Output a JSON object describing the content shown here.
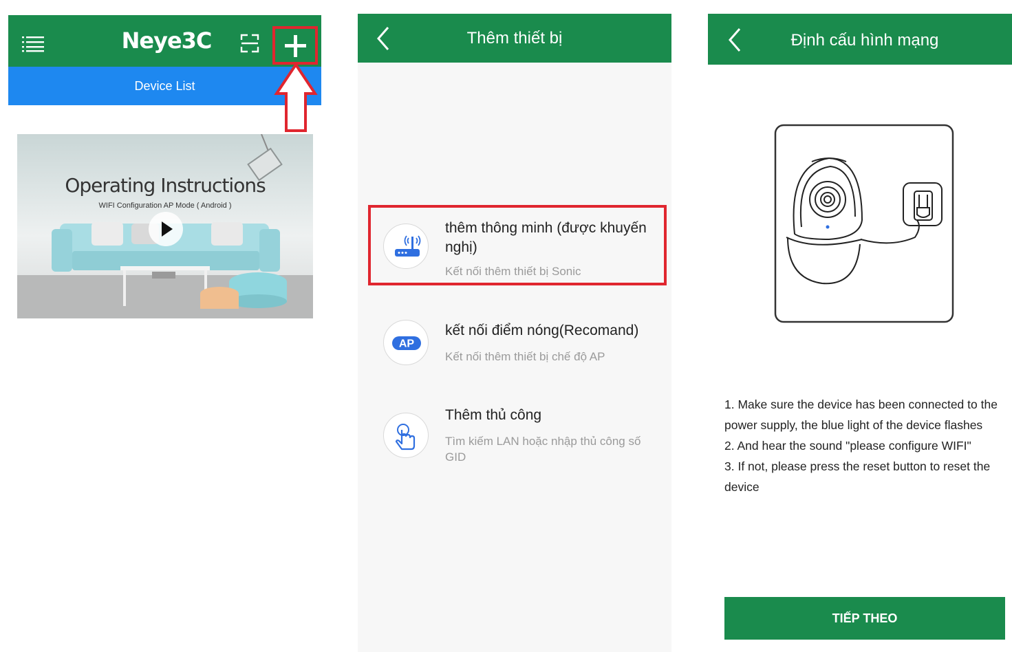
{
  "colors": {
    "brand_green": "#1a8b4d",
    "tab_blue": "#1e88f0",
    "highlight_red": "#e0262f"
  },
  "screen1": {
    "app_title": "Neye3C",
    "tab_label": "Device List",
    "icons": [
      "menu-icon",
      "scan-icon",
      "plus-icon"
    ],
    "video": {
      "title": "Operating Instructions",
      "subtitle": "WIFI Configuration AP Mode ( Android )"
    }
  },
  "screen2": {
    "title": "Thêm thiết bị",
    "options": [
      {
        "icon": "router-icon",
        "title": "thêm thông minh (được khuyến nghị)",
        "subtitle": "Kết nối thêm thiết bị Sonic"
      },
      {
        "icon": "ap-icon",
        "icon_text": "AP",
        "title": "kết nối điểm nóng(Recomand)",
        "subtitle": "Kết nối thêm thiết bị chế độ AP"
      },
      {
        "icon": "hand-pointer-icon",
        "title": "Thêm thủ công",
        "subtitle": "Tìm kiếm LAN hoặc nhập thủ công số GID"
      }
    ]
  },
  "screen3": {
    "title": "Định cấu hình mạng",
    "steps": [
      "1. Make sure the device has been connected to the power supply, the blue light of the device flashes",
      "2. And hear the sound \"please configure WIFI\"",
      "3. If not, please press the reset button to reset the device"
    ],
    "next_label": "TIẾP THEO"
  }
}
